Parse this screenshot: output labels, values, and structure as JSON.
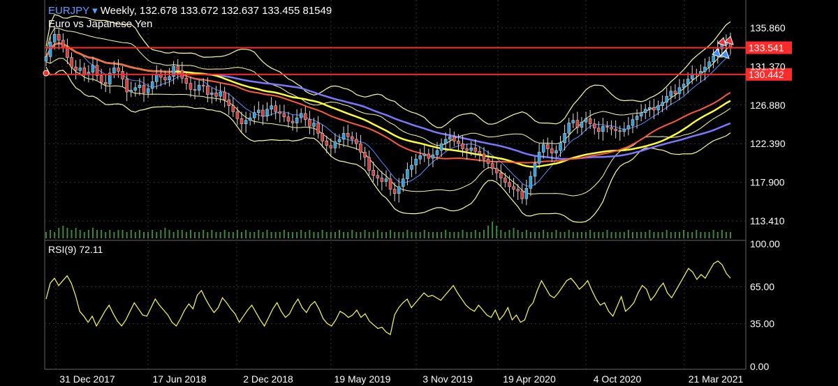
{
  "header": {
    "symbol": "EURJPY",
    "dropdown_glyph": "▾",
    "ohlc_line": "Weekly, 132.678 133.672 132.637 133.455 81549",
    "description": "Euro vs Japanese Yen"
  },
  "rsi_panel": {
    "label": "RSI(9) 72.11"
  },
  "colors": {
    "background": "#000000",
    "grid": "#333333",
    "axis_text": "#ffffff",
    "price_line": "#ff2a2a",
    "bollinger": "#ffff99",
    "ma_red": "#ff5a3c",
    "ma_yellow": "#ffff33",
    "ma_blue": "#7a78ff",
    "ma_fast": "#5a8cff",
    "candle_up": "#2a9fe0",
    "candle_down": "#d83a3a",
    "volume": "#3a8a3a",
    "rsi_line": "#ffff44",
    "symbol_text": "#5aa0ff"
  },
  "chart_data": [
    {
      "type": "candlestick",
      "title": "EURJPY",
      "subtitle": "Euro vs Japanese Yen",
      "timeframe": "Weekly",
      "last_bar": {
        "open": 132.678,
        "high": 133.672,
        "low": 132.637,
        "close": 133.455,
        "volume": 81549
      },
      "y_ticks": [
        135.86,
        131.37,
        126.88,
        122.39,
        117.9,
        113.41
      ],
      "y_tick_labels": [
        "135.860",
        "131.370",
        "126.880",
        "122.390",
        "117.900",
        "113.410"
      ],
      "ylim": [
        111.4,
        138.6
      ],
      "x_tick_labels": [
        "31 Dec 2017",
        "17 Jun 2018",
        "2 Dec 2018",
        "19 May 2019",
        "3 Nov 2019",
        "19 Apr 2020",
        "4 Oct 2020",
        "21 Mar 2021"
      ],
      "horizontal_lines": [
        {
          "label": "133.541",
          "value": 133.541
        },
        {
          "label": "130.442",
          "value": 130.442
        }
      ],
      "overlays": [
        "Bollinger Bands",
        "Moving Average (red)",
        "Moving Average (yellow)",
        "Moving Average (blue)",
        "Moving Average (fast)"
      ],
      "closes": [
        132.5,
        134.2,
        135.1,
        134.4,
        133.6,
        132.4,
        131.3,
        130.9,
        131.2,
        130.4,
        130.7,
        131.5,
        130.3,
        129.5,
        129.3,
        130.6,
        131.2,
        130.8,
        129.9,
        128.4,
        128.6,
        128.9,
        129.2,
        128.3,
        128.8,
        129.6,
        130.5,
        130.1,
        129.8,
        130.2,
        131.4,
        130.9,
        130.0,
        129.4,
        128.7,
        128.6,
        129.2,
        129.1,
        128.1,
        128.3,
        127.9,
        128.4,
        127.5,
        126.8,
        126.1,
        125.3,
        124.7,
        125.1,
        125.4,
        126.0,
        126.3,
        125.6,
        126.4,
        126.8,
        126.1,
        125.9,
        125.5,
        125.0,
        124.8,
        125.4,
        125.9,
        125.2,
        124.4,
        124.8,
        123.6,
        122.7,
        122.2,
        121.9,
        122.6,
        122.9,
        123.6,
        123.2,
        122.9,
        122.4,
        121.4,
        120.8,
        119.3,
        118.7,
        118.4,
        118.0,
        118.3,
        117.1,
        116.6,
        117.4,
        118.3,
        119.4,
        119.9,
        120.6,
        121.0,
        121.2,
        120.7,
        121.1,
        121.6,
        122.4,
        122.9,
        123.2,
        122.7,
        122.4,
        121.8,
        121.6,
        121.9,
        121.5,
        121.2,
        120.6,
        120.1,
        119.5,
        119.0,
        118.4,
        117.9,
        117.4,
        117.1,
        116.9,
        116.0,
        117.2,
        118.6,
        120.1,
        121.4,
        122.3,
        121.8,
        121.3,
        121.6,
        122.5,
        123.6,
        124.8,
        125.1,
        124.3,
        124.9,
        125.3,
        124.7,
        124.2,
        123.8,
        124.4,
        124.3,
        124.1,
        123.9,
        123.8,
        124.1,
        124.5,
        125.2,
        125.6,
        126.0,
        126.4,
        126.6,
        126.3,
        126.8,
        127.2,
        127.9,
        128.5,
        128.2,
        128.9,
        129.3,
        129.9,
        130.5,
        130.4,
        130.8,
        131.3,
        131.9,
        132.6,
        133.4,
        133.9,
        134.3,
        133.5
      ],
      "volumes": [
        3,
        4,
        3,
        5,
        6,
        5,
        4,
        5,
        4,
        3,
        4,
        5,
        4,
        4,
        3,
        4,
        3,
        4,
        4,
        3,
        4,
        3,
        4,
        3,
        3,
        4,
        3,
        4,
        5,
        4,
        3,
        4,
        4,
        3,
        4,
        3,
        3,
        4,
        3,
        4,
        3,
        3,
        4,
        3,
        3,
        4,
        3,
        4,
        3,
        3,
        4,
        3,
        4,
        3,
        3,
        3,
        4,
        3,
        3,
        3,
        4,
        3,
        4,
        3,
        3,
        4,
        3,
        3,
        3,
        4,
        3,
        3,
        4,
        3,
        3,
        4,
        3,
        3,
        4,
        3,
        3,
        4,
        3,
        3,
        3,
        4,
        3,
        3,
        3,
        4,
        3,
        3,
        3,
        3,
        4,
        3,
        3,
        3,
        4,
        3,
        3,
        4,
        3,
        4,
        6,
        8,
        6,
        4,
        3,
        4,
        5,
        4,
        3,
        4,
        3,
        3,
        3,
        4,
        3,
        3,
        4,
        3,
        3,
        4,
        3,
        3,
        3,
        3,
        4,
        3,
        3,
        3,
        4,
        3,
        3,
        3,
        3,
        4,
        3,
        3,
        3,
        3,
        4,
        3,
        3,
        3,
        4,
        3,
        3,
        3,
        4,
        3,
        3,
        4,
        3,
        3,
        3,
        4,
        3,
        4,
        3,
        3
      ]
    },
    {
      "type": "line",
      "title": "RSI(9)",
      "last_value": 72.11,
      "y_ticks": [
        100,
        65,
        35,
        0
      ],
      "y_tick_labels": [
        "100.00",
        "65.00",
        "35.00",
        "0.00"
      ],
      "ylim": [
        0,
        100
      ],
      "values": [
        55,
        68,
        72,
        66,
        70,
        74,
        68,
        58,
        45,
        41,
        36,
        41,
        33,
        39,
        45,
        50,
        43,
        37,
        33,
        38,
        45,
        52,
        47,
        42,
        41,
        48,
        55,
        50,
        46,
        42,
        36,
        33,
        39,
        46,
        51,
        47,
        58,
        62,
        55,
        49,
        44,
        48,
        56,
        52,
        47,
        43,
        36,
        41,
        46,
        50,
        44,
        38,
        33,
        40,
        47,
        52,
        45,
        40,
        43,
        50,
        55,
        48,
        44,
        50,
        53,
        47,
        39,
        35,
        33,
        38,
        45,
        43,
        40,
        42,
        46,
        40,
        43,
        37,
        34,
        31,
        32,
        28,
        26,
        42,
        48,
        52,
        55,
        48,
        52,
        56,
        60,
        57,
        58,
        56,
        54,
        58,
        62,
        66,
        60,
        55,
        50,
        47,
        45,
        50,
        46,
        42,
        40,
        46,
        38,
        42,
        48,
        38,
        42,
        36,
        38,
        48,
        52,
        62,
        70,
        64,
        58,
        56,
        60,
        65,
        70,
        72,
        68,
        63,
        66,
        70,
        62,
        55,
        50,
        52,
        45,
        41,
        49,
        57,
        45,
        48,
        52,
        60,
        66,
        63,
        54,
        58,
        64,
        68,
        60,
        56,
        62,
        68,
        74,
        80,
        77,
        71,
        75,
        72,
        78,
        84,
        86,
        83,
        76,
        72
      ],
      "x_tick_labels": [
        "31 Dec 2017",
        "17 Jun 2018",
        "2 Dec 2018",
        "19 May 2019",
        "3 Nov 2019",
        "19 Apr 2020",
        "4 Oct 2020",
        "21 Mar 2021"
      ]
    }
  ]
}
